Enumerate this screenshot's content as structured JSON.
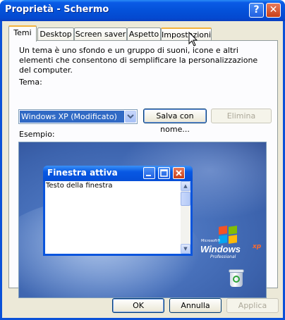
{
  "window": {
    "title": "Proprietà - Schermo",
    "help_btn": "?",
    "close_btn": "✕"
  },
  "tabs": [
    {
      "label": "Temi"
    },
    {
      "label": "Desktop"
    },
    {
      "label": "Screen saver"
    },
    {
      "label": "Aspetto"
    },
    {
      "label": "Impostazioni"
    }
  ],
  "temi": {
    "description": "Un tema è uno sfondo e un gruppo di suoni, icone e altri elementi che consentono di semplificare la personalizzazione del computer.",
    "tema_label": "Tema:",
    "tema_value": "Windows XP (Modificato)",
    "save_as": "Salva con nome...",
    "delete": "Elimina",
    "sample_label": "Esempio:"
  },
  "preview": {
    "window_title": "Finestra attiva",
    "window_text": "Testo della finestra",
    "logo_small": "Microsoft®",
    "logo_brand": "Windows",
    "logo_xp": "xp",
    "logo_edition": "Professional"
  },
  "footer": {
    "ok": "OK",
    "cancel": "Annulla",
    "apply": "Applica"
  }
}
